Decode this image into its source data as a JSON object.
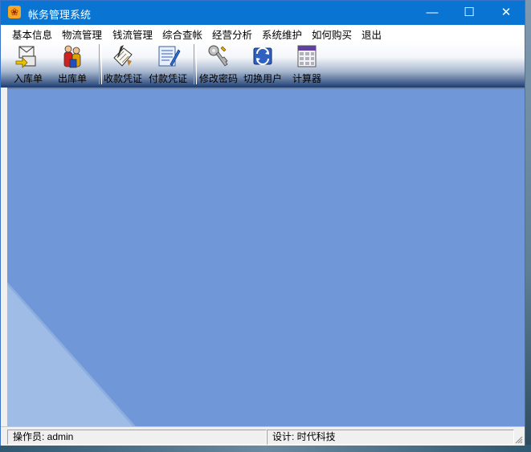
{
  "window": {
    "title": "帐务管理系统",
    "controls": {
      "minimize": "—",
      "maximize": "☐",
      "close": "✕"
    }
  },
  "menu": [
    "基本信息",
    "物流管理",
    "钱流管理",
    "综合查帐",
    "经营分析",
    "系统维护",
    "如何购买",
    "退出"
  ],
  "toolbar": [
    {
      "label": "入库单",
      "icon": "stock-in-icon"
    },
    {
      "label": "出库单",
      "icon": "stock-out-icon"
    },
    {
      "label": "收款凭证",
      "icon": "receipt-voucher-icon"
    },
    {
      "label": "付款凭证",
      "icon": "payment-voucher-icon"
    },
    {
      "label": "修改密码",
      "icon": "change-password-icon"
    },
    {
      "label": "切换用户",
      "icon": "switch-user-icon"
    },
    {
      "label": "计算器",
      "icon": "calculator-icon"
    }
  ],
  "status": {
    "operator": "操作员: admin",
    "design": "设计: 时代科技"
  },
  "colors": {
    "titlebar": "#0a74d3",
    "client_background": "#7097d7"
  }
}
